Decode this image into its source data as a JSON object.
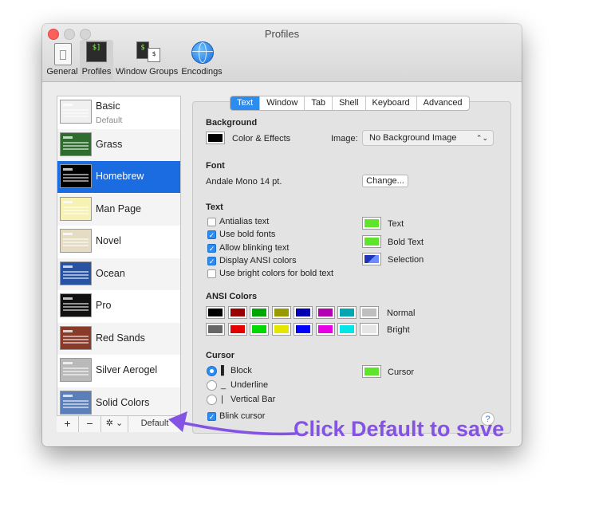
{
  "window": {
    "title": "Profiles"
  },
  "toolbar": [
    {
      "label": "General",
      "icon": "general-icon"
    },
    {
      "label": "Profiles",
      "icon": "profiles-terminal-icon",
      "active": true
    },
    {
      "label": "Window Groups",
      "icon": "window-groups-icon"
    },
    {
      "label": "Encodings",
      "icon": "globe-icon"
    }
  ],
  "profiles": [
    {
      "name": "Basic",
      "sub": "Default",
      "thumb": "#f0f0f0"
    },
    {
      "name": "Grass",
      "thumb": "#2f6d2f"
    },
    {
      "name": "Homebrew",
      "thumb": "#000000",
      "selected": true
    },
    {
      "name": "Man Page",
      "thumb": "#f7f1b2"
    },
    {
      "name": "Novel",
      "thumb": "#e6dcc3"
    },
    {
      "name": "Ocean",
      "thumb": "#2853a3"
    },
    {
      "name": "Pro",
      "thumb": "#111111"
    },
    {
      "name": "Red Sands",
      "thumb": "#8a3a28"
    },
    {
      "name": "Silver Aerogel",
      "thumb": "#b9b9b9"
    },
    {
      "name": "Solid Colors",
      "thumb": "#5b7fb8"
    }
  ],
  "profile_bar": {
    "add": "+",
    "remove": "−",
    "gear": "✲ ⌄",
    "default": "Default"
  },
  "tabs": [
    {
      "label": "Text",
      "active": true
    },
    {
      "label": "Window"
    },
    {
      "label": "Tab"
    },
    {
      "label": "Shell"
    },
    {
      "label": "Keyboard"
    },
    {
      "label": "Advanced"
    }
  ],
  "background": {
    "heading": "Background",
    "color_label": "Color & Effects",
    "color": "#000000",
    "image_label": "Image:",
    "image_value": "No Background Image"
  },
  "font": {
    "heading": "Font",
    "value": "Andale Mono 14 pt.",
    "change": "Change..."
  },
  "text": {
    "heading": "Text",
    "options": [
      {
        "label": "Antialias text",
        "checked": false
      },
      {
        "label": "Use bold fonts",
        "checked": true
      },
      {
        "label": "Allow blinking text",
        "checked": true
      },
      {
        "label": "Display ANSI colors",
        "checked": true
      },
      {
        "label": "Use bright colors for bold text",
        "checked": false
      }
    ],
    "colors": [
      {
        "label": "Text",
        "color": "#5ee52b"
      },
      {
        "label": "Bold Text",
        "color": "#5ee52b"
      },
      {
        "label": "Selection",
        "color": "#1f33b8"
      }
    ]
  },
  "ansi": {
    "heading": "ANSI Colors",
    "normal_label": "Normal",
    "bright_label": "Bright",
    "normal": [
      "#000000",
      "#990000",
      "#00a600",
      "#999900",
      "#0000b2",
      "#b200b2",
      "#00a6b2",
      "#bfbfbf"
    ],
    "bright": [
      "#666666",
      "#e50000",
      "#00d900",
      "#e5e500",
      "#0000ff",
      "#e500e5",
      "#00e5e5",
      "#e5e5e5"
    ]
  },
  "cursor": {
    "heading": "Cursor",
    "options": [
      {
        "glyph": "▌",
        "label": "Block",
        "selected": true
      },
      {
        "glyph": "_",
        "label": "Underline",
        "selected": false
      },
      {
        "glyph": "|",
        "label": "Vertical Bar",
        "selected": false
      }
    ],
    "blink_label": "Blink cursor",
    "blink": true,
    "color_label": "Cursor",
    "color": "#5ee52b"
  },
  "help": "?",
  "annotation": {
    "text": "Click Default to save",
    "color": "#8453e3"
  }
}
